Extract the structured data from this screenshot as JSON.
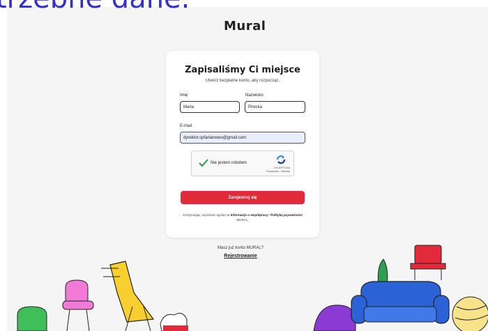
{
  "overlay_caption": "trzebne dane.",
  "brand": {
    "logo_text": "Mural"
  },
  "signup": {
    "title": "Zapisaliśmy Ci miejsce",
    "subtitle": "Utwórz bezpłatne konto, aby rozpocząć.",
    "first_name": {
      "label": "Imię",
      "value": "Maria"
    },
    "last_name": {
      "label": "Nazwisko",
      "value": "Pirecka"
    },
    "email": {
      "label": "E-mail",
      "value": "dyrektor.spfanianowo@gmail.com"
    },
    "captcha": {
      "label": "Nie jestem robotem",
      "brand": "reCAPTCHA",
      "links": "Prywatność - Warunki",
      "checked": true
    },
    "submit_label": "Zarejestruj się",
    "consent": {
      "prefix": "Kontynuując, wyrażasz zgodę na",
      "terms_link": "Informacje o współpracy",
      "separator": " i ",
      "privacy_link": "Polityką prywatności",
      "suffix": " MURAL."
    }
  },
  "footer": {
    "question": "Masz już konto MURAL?",
    "link_label": "Rejestrowanie"
  },
  "colors": {
    "accent": "#e22b3a",
    "caption": "#3330c8",
    "email_bg": "#e8eefc"
  },
  "icons": [
    "check-icon",
    "recaptcha-icon"
  ]
}
